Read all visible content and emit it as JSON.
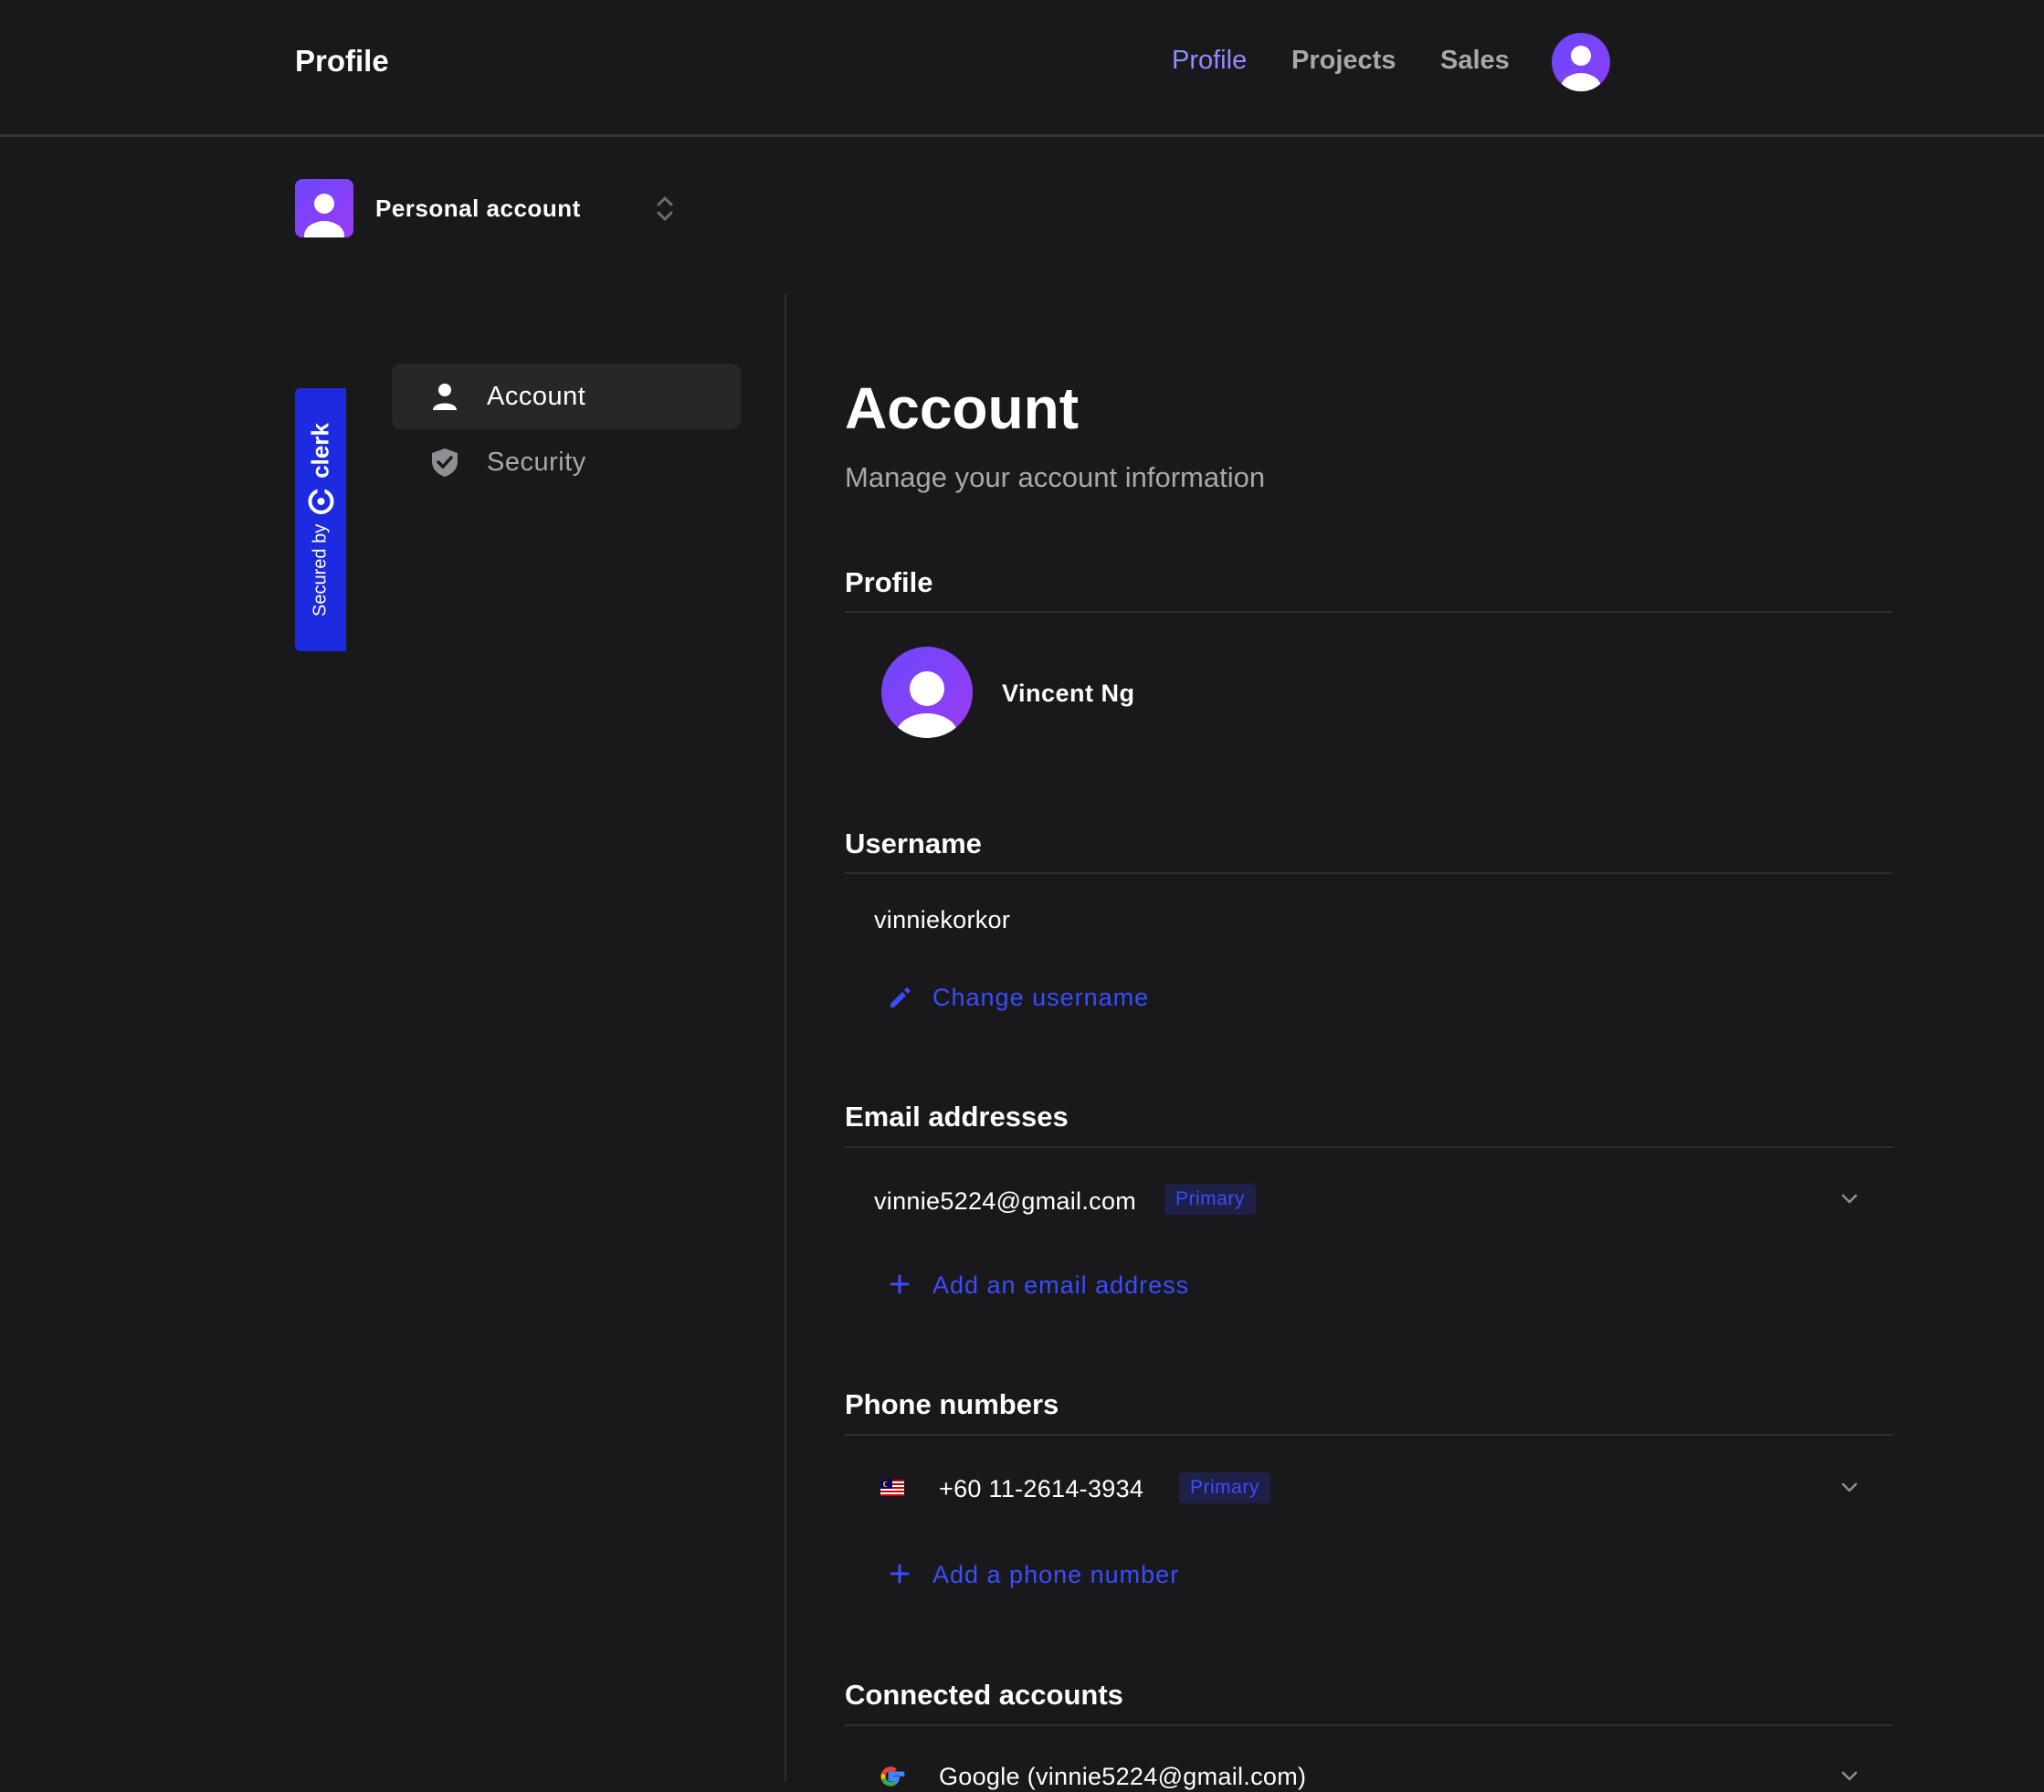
{
  "header": {
    "brand": "Profile",
    "nav": [
      {
        "label": "Profile",
        "active": true
      },
      {
        "label": "Projects",
        "active": false
      },
      {
        "label": "Sales",
        "active": false
      }
    ],
    "avatar_icon": "user-avatar-icon"
  },
  "org_switcher": {
    "name": "Personal account",
    "icon": "chevron-up-down-icon"
  },
  "badge": {
    "secured_by": "Secured by",
    "brand": "clerk"
  },
  "sidebar": {
    "items": [
      {
        "label": "Account",
        "icon": "user-icon",
        "active": true
      },
      {
        "label": "Security",
        "icon": "shield-check-icon",
        "active": false
      }
    ]
  },
  "main": {
    "title": "Account",
    "subtitle": "Manage your account information",
    "profile": {
      "section_title": "Profile",
      "name": "Vincent Ng"
    },
    "username": {
      "section_title": "Username",
      "value": "vinniekorkor",
      "action": "Change username"
    },
    "email": {
      "section_title": "Email addresses",
      "value": "vinnie5224@gmail.com",
      "badge": "Primary",
      "action": "Add an email address"
    },
    "phone": {
      "section_title": "Phone numbers",
      "value": "+60 11-2614-3934",
      "badge": "Primary",
      "action": "Add a phone number"
    },
    "connected": {
      "section_title": "Connected accounts",
      "value": "Google (vinnie5224@gmail.com)"
    }
  },
  "colors": {
    "background": "#19191b",
    "accent": "#3b4cff",
    "nav_active": "#8f8cff",
    "avatar_gradient_start": "#6c47ff",
    "secured_badge": "#1d2be0"
  }
}
